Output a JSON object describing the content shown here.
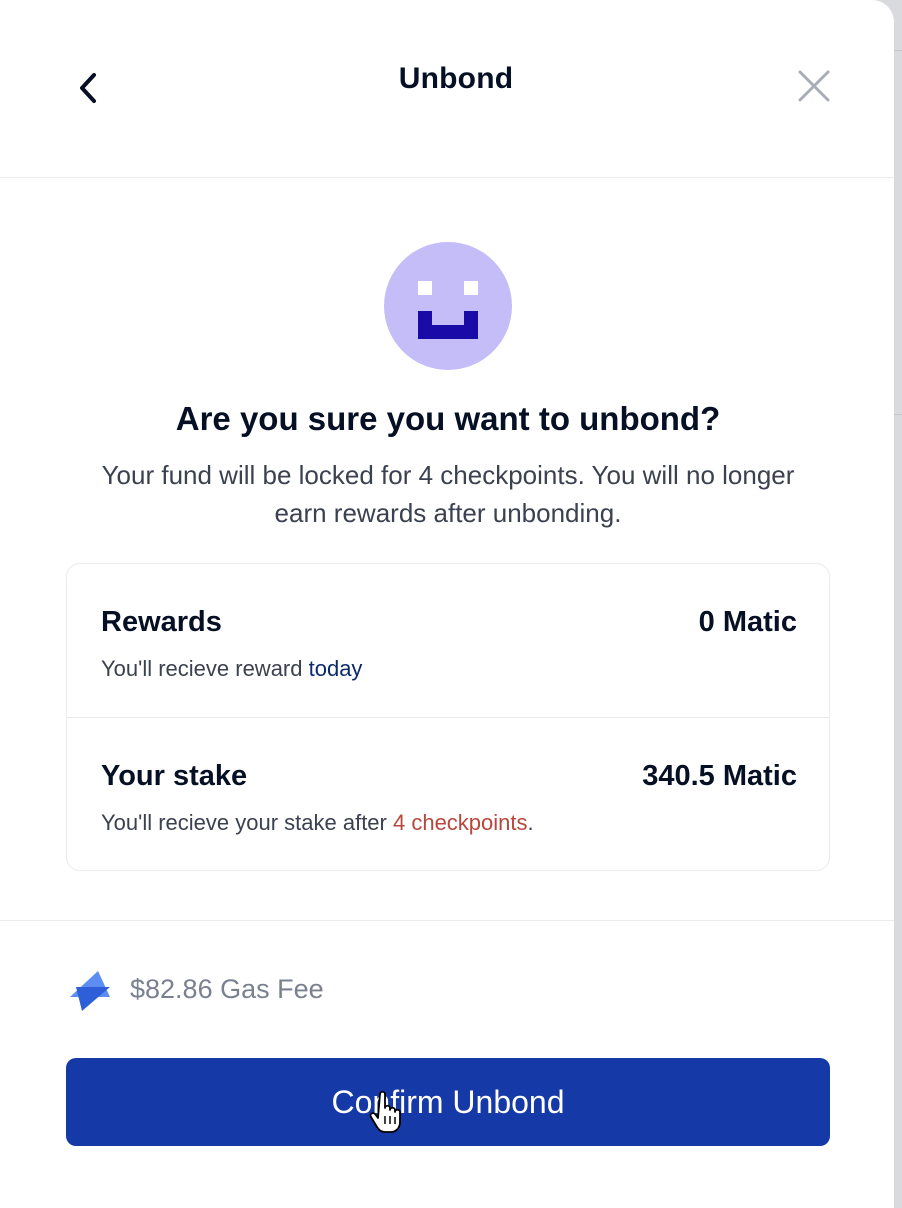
{
  "header": {
    "title": "Unbond",
    "back_icon": "chevron-left-icon",
    "close_icon": "close-icon"
  },
  "avatar": {
    "icon": "pixel-smiley-avatar",
    "bg_color": "#c5bdf7",
    "face_color": "#1a0aa8"
  },
  "confirm": {
    "heading": "Are you sure you want to unbond?",
    "description": "Your fund will be locked for 4 checkpoints. You will no longer earn rewards after unbonding."
  },
  "summary": {
    "rewards": {
      "label": "Rewards",
      "value": "0 Matic",
      "sub_prefix": "You'll recieve reward ",
      "sub_highlight": "today"
    },
    "stake": {
      "label": "Your stake",
      "value": "340.5 Matic",
      "sub_prefix": "You'll recieve your stake after ",
      "sub_highlight": "4 checkpoints",
      "sub_suffix": "."
    }
  },
  "gas": {
    "icon": "lightning-icon",
    "text": "$82.86 Gas Fee"
  },
  "actions": {
    "confirm_label": "Confirm Unbond",
    "accent_color": "#1639a8"
  }
}
